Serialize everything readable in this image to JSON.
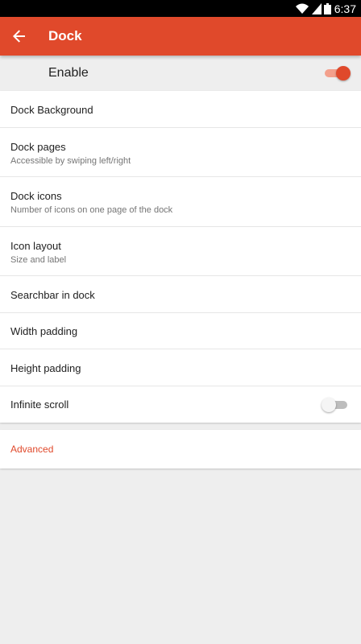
{
  "status_bar": {
    "time": "6:37"
  },
  "app_bar": {
    "title": "Dock"
  },
  "enable": {
    "label": "Enable",
    "enabled": true
  },
  "settings": [
    {
      "title": "Dock Background"
    },
    {
      "title": "Dock pages",
      "subtitle": "Accessible by swiping left/right"
    },
    {
      "title": "Dock icons",
      "subtitle": "Number of icons on one page of the dock"
    },
    {
      "title": "Icon layout",
      "subtitle": "Size and label"
    },
    {
      "title": "Searchbar in dock"
    },
    {
      "title": "Width padding"
    },
    {
      "title": "Height padding"
    },
    {
      "title": "Infinite scroll",
      "toggle": false
    }
  ],
  "advanced": {
    "label": "Advanced"
  },
  "colors": {
    "accent": "#e0492b",
    "background": "#eeeeee",
    "status_bar": "#000000"
  }
}
